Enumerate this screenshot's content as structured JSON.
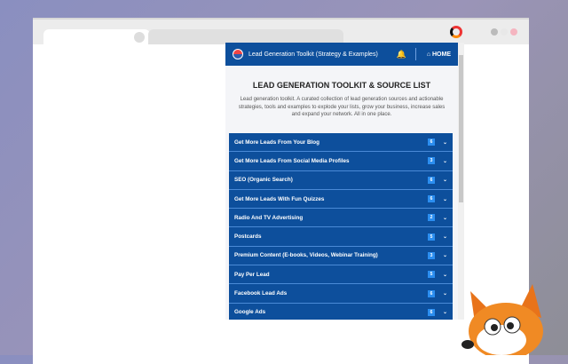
{
  "popup": {
    "header_title": "Lead Generation Toolkit (Strategy & Examples)",
    "home_label": "HOME",
    "title": "LEAD GENERATION TOOLKIT & SOURCE LIST",
    "description": "Lead generation toolkit. A curated collection of lead generation sources and actionable strategies, tools and examples to explode your lists, grow your business, increase sales and expand your network. All in one place.",
    "items": [
      {
        "label": "Get More Leads From Your Blog",
        "count": "6"
      },
      {
        "label": "Get More Leads From Social Media Profiles",
        "count": "3"
      },
      {
        "label": "SEO (Organic Search)",
        "count": "6"
      },
      {
        "label": "Get More Leads With Fun Quizzes",
        "count": "6"
      },
      {
        "label": "Radio And TV Advertising",
        "count": "2"
      },
      {
        "label": "Postcards",
        "count": "5"
      },
      {
        "label": "Premium Content (E-books, Videos, Webinar Training)",
        "count": "3"
      },
      {
        "label": "Pay Per Lead",
        "count": "5"
      },
      {
        "label": "Facebook Lead Ads",
        "count": "6"
      },
      {
        "label": "Google Ads",
        "count": "6"
      }
    ]
  }
}
